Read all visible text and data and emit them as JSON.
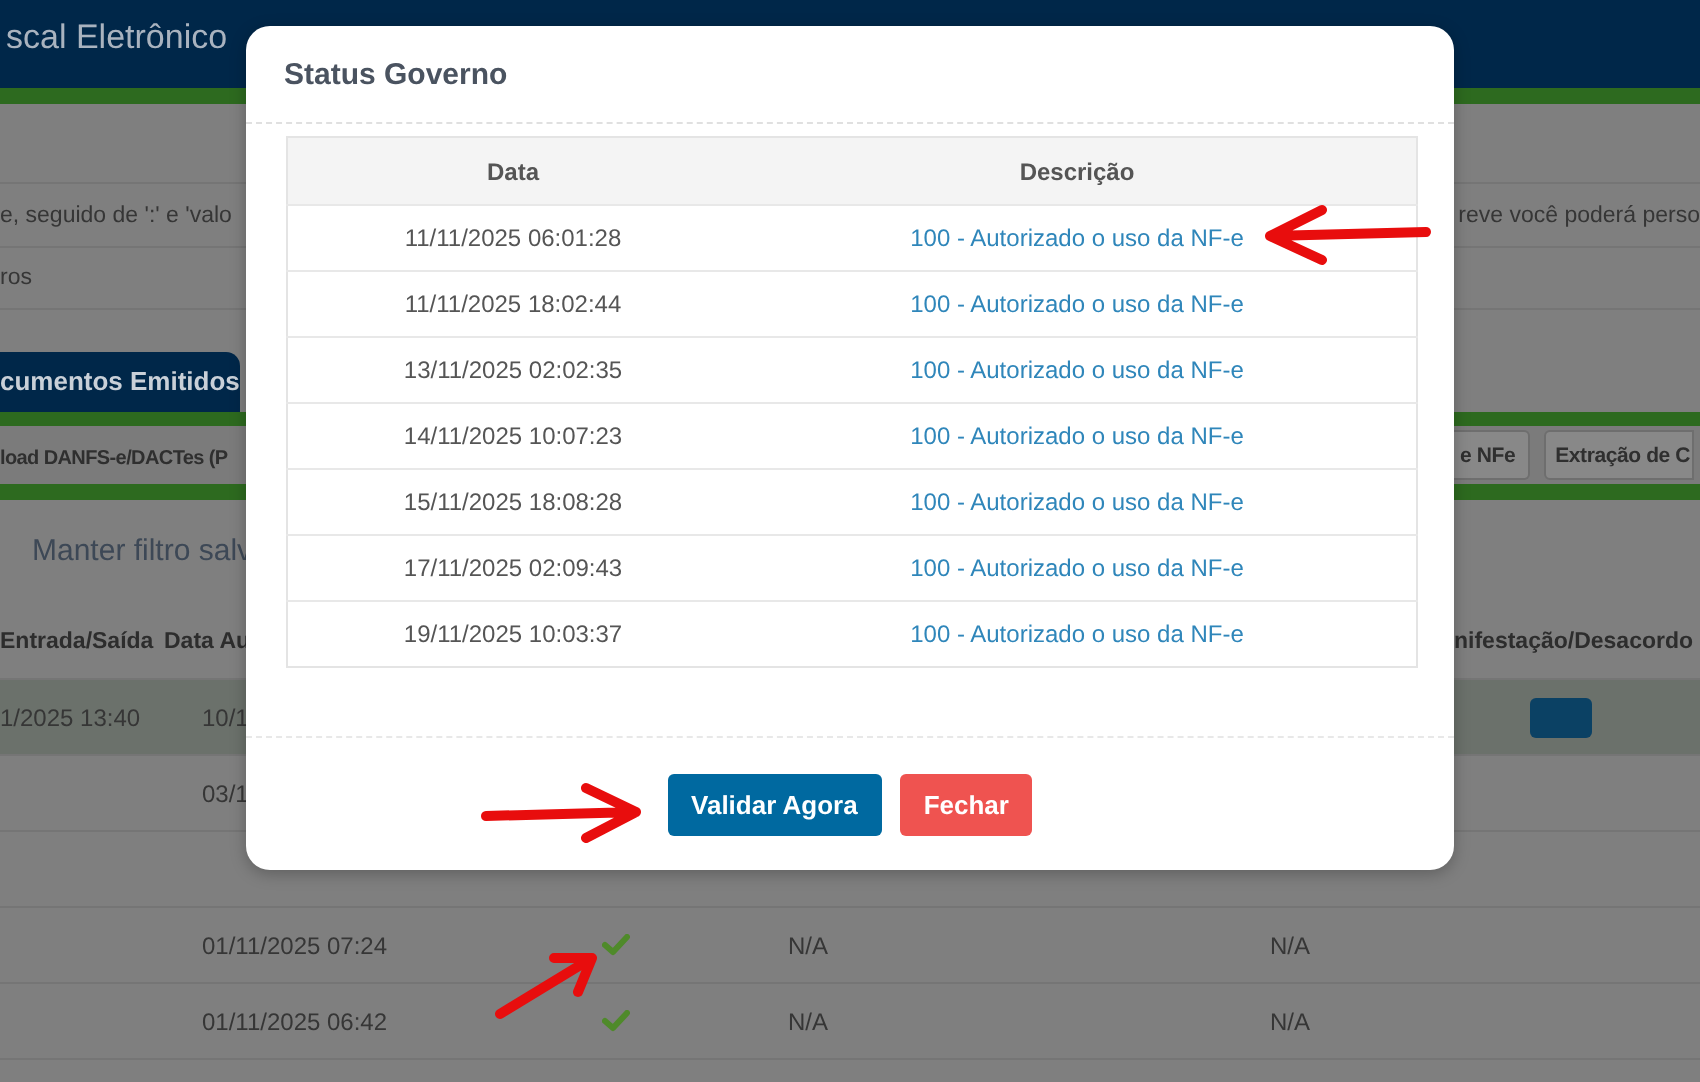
{
  "background": {
    "app_title": "scal Eletrônico",
    "hint_left": "e, seguido de ':' e 'valo",
    "hint_right": "reve você poderá perso",
    "filters_link": "ros",
    "tab": {
      "label": "cumentos Emitidos",
      "selected": true
    },
    "toolbar_left": "load DANFS-e/DACTes (P",
    "toolbar_buttons": [
      "e NFe",
      "Extração de C"
    ],
    "keep_filter": "Manter filtro salv",
    "columns_left": [
      "Entrada/Saída",
      "Data Au"
    ],
    "column_right": "nifestação/Desacordo",
    "rows": [
      {
        "entry": "1/2025 13:40",
        "date": "10/1",
        "highlighted": true,
        "action_button": true
      },
      {
        "date": "03/1",
        "highlighted": false
      },
      {
        "highlighted": false
      },
      {
        "date": "01/11/2025 07:24",
        "checked": true,
        "col_a": "N/A",
        "col_b": "N/A",
        "highlighted": false
      },
      {
        "date": "01/11/2025 06:42",
        "checked": true,
        "col_a": "N/A",
        "col_b": "N/A",
        "highlighted": false
      }
    ]
  },
  "modal": {
    "title": "Status Governo",
    "columns": [
      "Data",
      "Descrição"
    ],
    "rows": [
      {
        "date": "11/11/2025 06:01:28",
        "description": "100 - Autorizado o uso da NF-e"
      },
      {
        "date": "11/11/2025 18:02:44",
        "description": "100 - Autorizado o uso da NF-e"
      },
      {
        "date": "13/11/2025 02:02:35",
        "description": "100 - Autorizado o uso da NF-e"
      },
      {
        "date": "14/11/2025 10:07:23",
        "description": "100 - Autorizado o uso da NF-e"
      },
      {
        "date": "15/11/2025 18:08:28",
        "description": "100 - Autorizado o uso da NF-e"
      },
      {
        "date": "17/11/2025 02:09:43",
        "description": "100 - Autorizado o uso da NF-e"
      },
      {
        "date": "19/11/2025 10:03:37",
        "description": "100 - Autorizado o uso da NF-e"
      }
    ],
    "buttons": [
      {
        "label": "Validar Agora",
        "kind": "primary"
      },
      {
        "label": "Fechar",
        "kind": "danger"
      }
    ]
  }
}
